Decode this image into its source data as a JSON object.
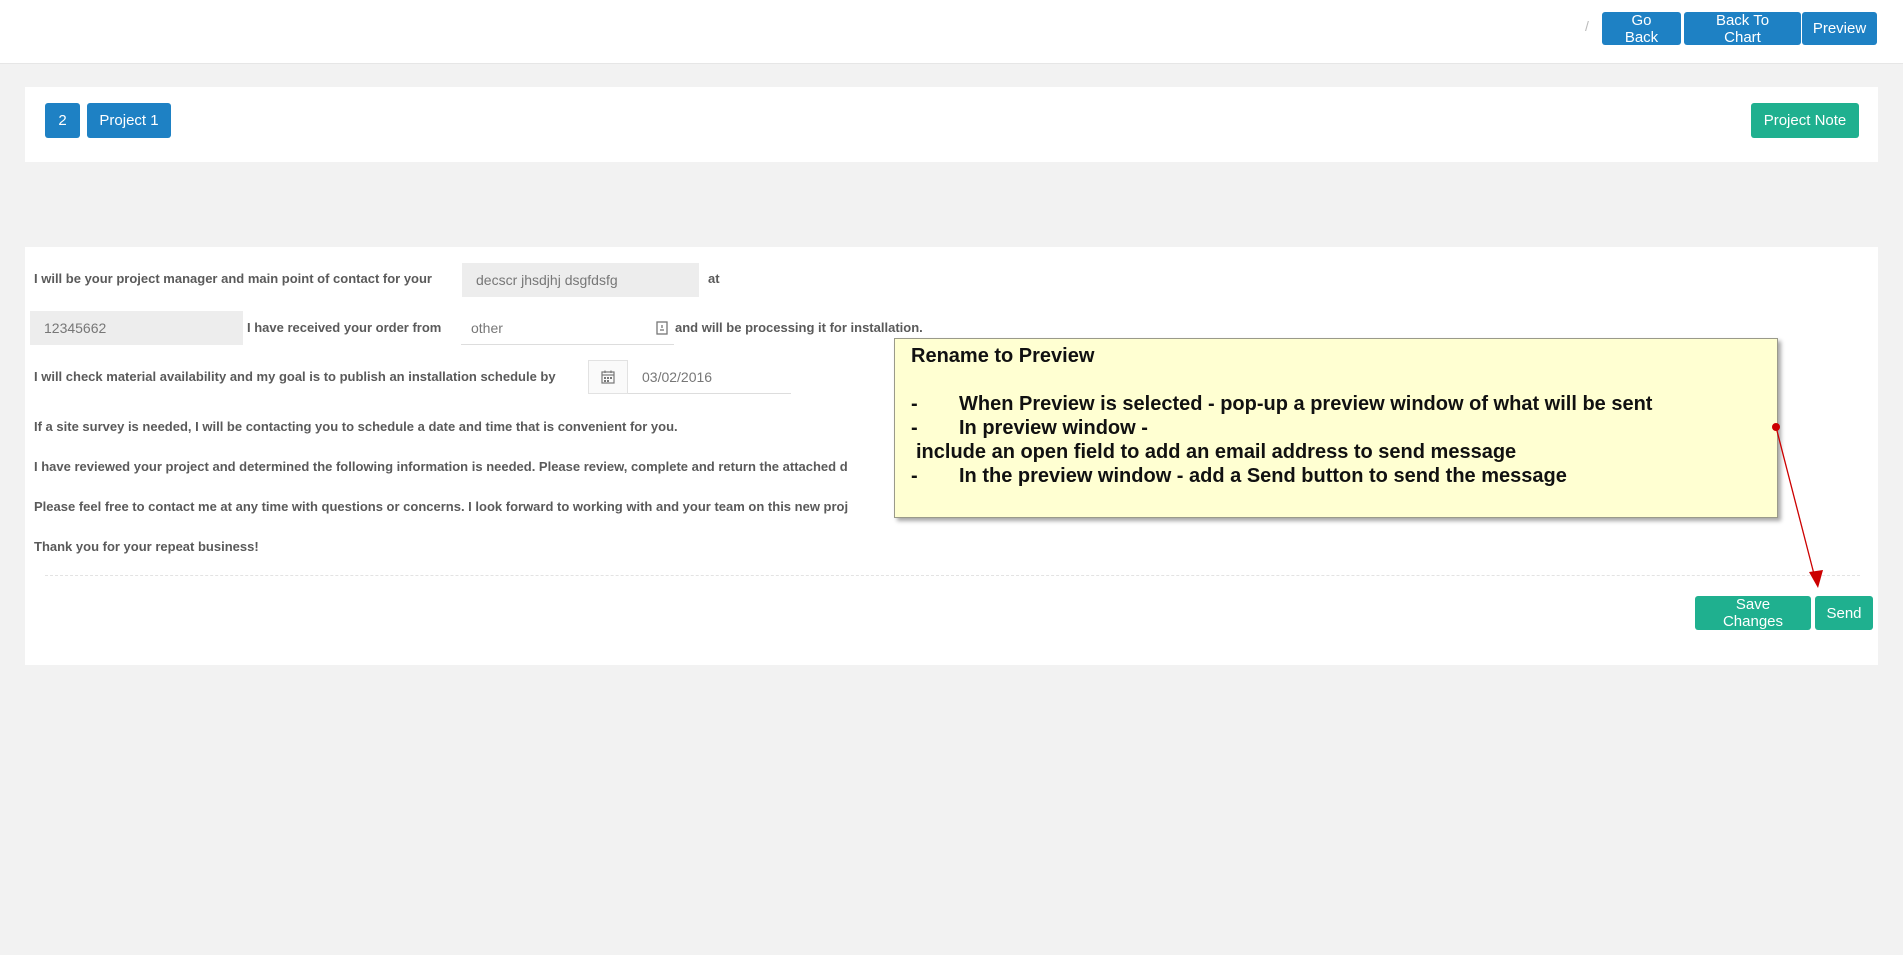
{
  "header": {
    "breadcrumb_separator": "/",
    "go_back": "Go Back",
    "back_to_chart": "Back To Chart",
    "preview": "Preview"
  },
  "project_bar": {
    "number": "2",
    "project": "Project 1",
    "project_note": "Project Note"
  },
  "letter": {
    "line1_text": "I will be your project manager and main point of contact for your",
    "line1_field": "decscr jhsdjhj dsgfdsfg",
    "line1_after": "at",
    "line2_field": "12345662",
    "line2_text": "I have received your order from",
    "line2_select": "other",
    "line2_after": "and will be processing it for installation.",
    "line3_text": "I will check material availability and my goal is to publish an installation schedule by",
    "line3_date": "03/02/2016",
    "line4": "If a site survey is needed, I will be contacting you to schedule a date and time that is convenient for you.",
    "line5": "I have reviewed your project and determined the following information is needed. Please review, complete and return the attached d",
    "line6": "Please feel free to contact me at any time with questions or concerns. I look forward to working with and your team on this new proj",
    "line7": "Thank you for your repeat business!"
  },
  "actions": {
    "save_changes": "Save Changes",
    "send": "Send"
  },
  "annotation": {
    "title": "Rename to Preview",
    "bullet1_dash": "-",
    "bullet1": "When Preview is selected - pop-up a preview window of what will be sent",
    "bullet2_dash": "-",
    "bullet2": "In preview window -",
    "bullet2_cont": "include an open field to add an email address to send message",
    "bullet3_dash": "-",
    "bullet3": "In the preview window - add a Send button to send the message"
  },
  "colors": {
    "primary": "#1e81c4",
    "success": "#1fb08f",
    "note_bg": "#ffffd2",
    "arrow": "#cc0000"
  }
}
